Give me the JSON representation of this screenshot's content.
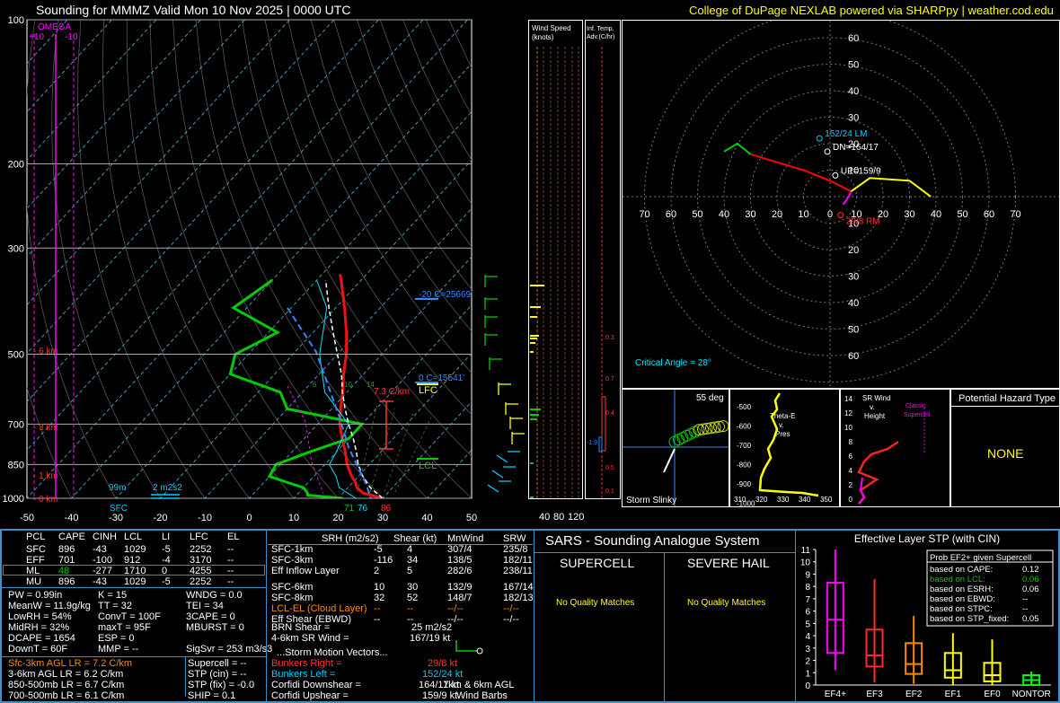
{
  "header": {
    "title": "Sounding for MMMZ Valid  Mon 10 Nov 2025 | 0000 UTC",
    "credit": "College of DuPage NEXLAB powered via SHARPpy | weather.cod.edu"
  },
  "colors": {
    "bg": "#000000",
    "temp": "#ff0000",
    "dewpoint": "#00cc00",
    "parcel": "#ffffff",
    "yellow": "#ffff00",
    "cyan": "#00ffff",
    "magenta": "#ff00ff",
    "blue_panel": "#3a8fd0",
    "orange": "#ff8800"
  },
  "skewt": {
    "p_ticks": [
      "100",
      "200",
      "300",
      "500",
      "700",
      "850",
      "1000"
    ],
    "t_ticks": [
      "-50",
      "-40",
      "-30",
      "-20",
      "-10",
      "0",
      "10",
      "20",
      "30",
      "40",
      "50"
    ],
    "omega_label": "OMEGA",
    "omega_ticks": [
      "+10",
      "-10"
    ],
    "height_labels": [
      "6 km",
      "3 km",
      "1 km",
      "0 km"
    ],
    "annotations": {
      "c20": "-20 C=25669'",
      "c0": "0 C=15541'",
      "lapse": "7.3 C/km",
      "lfc": "LFC",
      "lcl": "LCL",
      "m99": "99m",
      "srh2": "2 m2s2",
      "sfc": "SFC",
      "td_sfc": "71",
      "wb_sfc": "76",
      "t_sfc": "86"
    },
    "mix_ticks": [
      "6",
      "10",
      "14"
    ]
  },
  "chart_data": [
    {
      "type": "line",
      "title": "",
      "xlabel": "",
      "ylabel": "",
      "xlim": [
        -50,
        50
      ],
      "pressure_levels_hpa": [
        100,
        200,
        300,
        500,
        700,
        850,
        1000
      ],
      "series": [
        {
          "name": "",
          "kind": "temperature",
          "p": [
            1000,
            975,
            950,
            925,
            900,
            850,
            800,
            750,
            700,
            650,
            600,
            550,
            500,
            450,
            400,
            350,
            340
          ],
          "t": [
            30,
            24.5,
            22,
            20.5,
            18.5,
            15,
            12,
            8.5,
            5,
            2,
            -1,
            -4.5,
            -8,
            -12.5,
            -18,
            -24.5,
            -26
          ]
        },
        {
          "name": "",
          "kind": "dewpoint",
          "p": [
            1000,
            985,
            975,
            950,
            925,
            900,
            850,
            800,
            750,
            700,
            650,
            600,
            550,
            500,
            450,
            400,
            350
          ],
          "t": [
            21,
            12.5,
            12,
            10,
            5,
            0,
            -1,
            4,
            10,
            10,
            -10,
            -15,
            -30,
            -33,
            -28,
            -43,
            -40
          ]
        },
        {
          "name": "",
          "kind": "parcel",
          "p": [
            1000,
            950,
            900,
            850,
            800,
            750,
            700,
            650,
            600,
            550,
            500,
            450,
            400,
            350
          ],
          "t": [
            30,
            25,
            21,
            17.5,
            14.5,
            11,
            7,
            3,
            -1,
            -5,
            -10,
            -15.5,
            -21.5,
            -28
          ]
        },
        {
          "name": "",
          "kind": "wetbulb",
          "p": [
            1000,
            950,
            900,
            850,
            800,
            700,
            600,
            500,
            400,
            350
          ],
          "t": [
            24,
            18,
            15,
            11,
            10,
            7,
            -5,
            -14,
            -22,
            -30
          ]
        }
      ]
    },
    {
      "type": "scatter",
      "title": "",
      "xlabel": "",
      "ylabel": "",
      "xlim": [
        -70,
        70
      ],
      "ylim": [
        -70,
        70
      ],
      "rings": [
        10,
        20,
        30,
        40,
        50,
        60,
        70
      ],
      "hodograph": {
        "segments": [
          {
            "color": "#ff00ff",
            "u": [
              5,
              7,
              8
            ],
            "v": [
              -3,
              0,
              2
            ]
          },
          {
            "color": "#ff0000",
            "u": [
              8,
              0,
              -10,
              -30
            ],
            "v": [
              2,
              6,
              10,
              16
            ]
          },
          {
            "color": "#00cc00",
            "u": [
              -30,
              -35,
              -40
            ],
            "v": [
              16,
              20,
              17
            ]
          },
          {
            "color": "#ffff00",
            "u": [
              8,
              15,
              30,
              38
            ],
            "v": [
              2,
              7,
              6,
              0
            ]
          }
        ],
        "points": [
          {
            "label": "152/24 LM",
            "u": -4,
            "v": 22
          },
          {
            "label": "DN=164/17",
            "u": -1,
            "v": 17
          },
          {
            "label": "UP=159/9",
            "u": 2,
            "v": 8
          },
          {
            "label": "29/8 RM",
            "u": 4,
            "v": -7
          }
        ],
        "critical_angle": "Critical Angle = 28°"
      }
    },
    {
      "type": "bar",
      "title": "Effective Layer STP (with CIN)",
      "categories": [
        "EF4+",
        "EF3",
        "EF2",
        "EF1",
        "EF0",
        "NONTOR"
      ],
      "ylim": [
        0,
        11
      ],
      "boxes": [
        {
          "cat": "EF4+",
          "min": 1.2,
          "q1": 2.6,
          "med": 5.3,
          "q3": 8.3,
          "max": 11,
          "color": "#ff00ff"
        },
        {
          "cat": "EF3",
          "min": 0.2,
          "q1": 1.5,
          "med": 2.4,
          "q3": 4.5,
          "max": 8.6,
          "color": "#ff2a2a"
        },
        {
          "cat": "EF2",
          "min": 0.1,
          "q1": 0.9,
          "med": 1.7,
          "q3": 3.4,
          "max": 5.6,
          "color": "#ff8800"
        },
        {
          "cat": "EF1",
          "min": 0,
          "q1": 0.6,
          "med": 1.2,
          "q3": 2.6,
          "max": 4.2,
          "color": "#ffff00"
        },
        {
          "cat": "EF0",
          "min": 0,
          "q1": 0.3,
          "med": 0.8,
          "q3": 1.8,
          "max": 3.7,
          "color": "#ffff00"
        },
        {
          "cat": "NONTOR",
          "min": 0,
          "q1": 0,
          "med": 0.4,
          "q3": 0.8,
          "max": 1.1,
          "color": "#00ff00"
        }
      ]
    }
  ],
  "wind_speed": {
    "title1": "Wind Speed",
    "title2": "(knots)",
    "ticks": [
      "40",
      "80",
      "120"
    ]
  },
  "inf_temp": {
    "title": "Inf. Temp. Adv.(C/hr)",
    "labels": [
      "0.3",
      "0.7",
      "0.4",
      "-1.9",
      "0.5",
      "0.1"
    ]
  },
  "hodo_axis_labels": [
    "70",
    "60",
    "50",
    "40",
    "30",
    "20",
    "10",
    "0",
    "10",
    "20",
    "30",
    "40",
    "50",
    "60",
    "70"
  ],
  "hodo_v_labels": [
    "60",
    "50",
    "40",
    "30",
    "20",
    "10",
    "10",
    "20",
    "30",
    "40",
    "50",
    "60"
  ],
  "storm_slinky": {
    "deg": "55 deg",
    "label": "Storm Slinky"
  },
  "theta_e": {
    "title": "Theta-E v. Pres",
    "y_ticks": [
      "500",
      "600",
      "700",
      "800",
      "900",
      "1000"
    ],
    "x_ticks": [
      "310",
      "320",
      "330",
      "340",
      "350"
    ]
  },
  "sr_wind": {
    "title": "SR Wind v. Height",
    "classic": "Classic Supercell",
    "y_ticks": [
      "14",
      "12",
      "10",
      "8",
      "6",
      "4",
      "2",
      "0"
    ]
  },
  "hazard": {
    "title": "Potential Hazard Type",
    "value": "NONE"
  },
  "parcels": {
    "headers": [
      "PCL",
      "CAPE",
      "CINH",
      "LCL",
      "LI",
      "LFC",
      "EL"
    ],
    "rows": [
      [
        "SFC",
        "896",
        "-43",
        "1029",
        "-5",
        "2252",
        "--"
      ],
      [
        "EFF",
        "701",
        "-100",
        "912",
        "-4",
        "3170",
        "--"
      ],
      [
        "ML",
        "48",
        "-277",
        "1710",
        "0",
        "4255",
        "--"
      ],
      [
        "MU",
        "896",
        "-43",
        "1029",
        "-5",
        "2252",
        "--"
      ]
    ]
  },
  "thermo": {
    "col1": [
      "PW = 0.99in",
      "MeanW = 11.9g/kg",
      "LowRH = 54%",
      "MidRH = 32%",
      "DCAPE = 1654",
      "DownT = 60F"
    ],
    "col2": [
      "K = 15",
      "TT = 32",
      "ConvT = 100F",
      "maxT = 95F",
      "ESP = 0",
      "MMP = --"
    ],
    "col3": [
      "WNDG = 0.0",
      "TEI = 34",
      "3CAPE = 0",
      "MBURST = 0",
      "",
      "SigSvr = 253 m3/s3"
    ],
    "lapse": [
      "Sfc-3km AGL LR = 7.2 C/km",
      "3-6km AGL LR = 6.2 C/km",
      "850-500mb LR = 6.7 C/km",
      "700-500mb LR = 6.1 C/km"
    ],
    "comp": [
      "Supercell = --",
      "STP (cin) = --",
      "STP (fix) = -0.0",
      "SHIP = 0.1"
    ]
  },
  "kinematics": {
    "headers": [
      "SRH (m2/s2)",
      "Shear (kt)",
      "MnWind",
      "SRW"
    ],
    "rows": [
      [
        "SFC-1km",
        "-5",
        "4",
        "307/4",
        "235/8"
      ],
      [
        "SFC-3km",
        "-116",
        "34",
        "138/5",
        "182/11"
      ],
      [
        "Eff Inflow Layer",
        "2",
        "5",
        "282/6",
        "238/11"
      ],
      [
        "SFC-6km",
        "10",
        "30",
        "132/9",
        "167/14"
      ],
      [
        "SFC-8km",
        "32",
        "52",
        "148/7",
        "182/13"
      ],
      [
        "LCL-EL (Cloud Layer)",
        "--",
        "--",
        "--/--",
        "--/--"
      ],
      [
        "Eff Shear (EBWD)",
        "--",
        "--",
        "--/--",
        "--/--"
      ]
    ],
    "brn": [
      "BRN Shear =",
      "25 m2/s2"
    ],
    "srw46": [
      "4-6km SR Wind =",
      "167/19 kt"
    ],
    "sm_title": "...Storm Motion Vectors...",
    "bunkers_r": [
      "Bunkers Right =",
      "29/8 kt"
    ],
    "bunkers_l": [
      "Bunkers Left =",
      "152/24 kt"
    ],
    "corfidi_d": [
      "Corfidi Downshear =",
      "164/17 kt"
    ],
    "corfidi_u": [
      "Corfidi Upshear =",
      "159/9 kt"
    ],
    "barbs1": "1km & 6km AGL",
    "barbs2": "Wind Barbs"
  },
  "sars": {
    "title": "SARS - Sounding Analogue System",
    "supercell": "SUPERCELL",
    "hail": "SEVERE HAIL",
    "no_match": "No Quality Matches"
  },
  "stp_box": {
    "title": "Prob EF2+ given Supercell",
    "rows": [
      [
        "based on CAPE:",
        "0.12"
      ],
      [
        "based on LCL:",
        "0.06"
      ],
      [
        "based on ESRH:",
        "0.06"
      ],
      [
        "based on EBWD:",
        "--"
      ],
      [
        "based on STPC:",
        "--"
      ],
      [
        "based on STP_fixed:",
        "0.05"
      ]
    ]
  }
}
